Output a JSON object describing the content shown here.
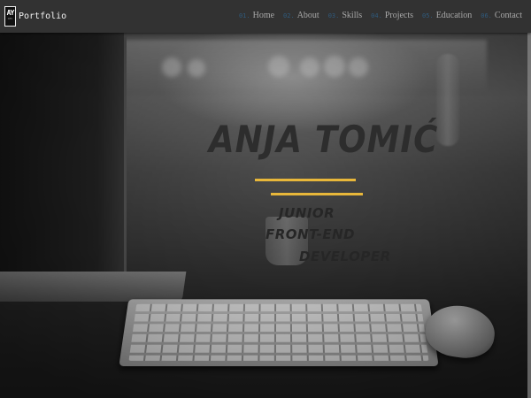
{
  "brand": {
    "logo_mark": "AY",
    "logo_tag": "DEV",
    "name": "Portfolio"
  },
  "nav": {
    "items": [
      {
        "num": "01.",
        "label": "Home"
      },
      {
        "num": "02.",
        "label": "About"
      },
      {
        "num": "03.",
        "label": "Skills"
      },
      {
        "num": "04.",
        "label": "Projects"
      },
      {
        "num": "05.",
        "label": "Education"
      },
      {
        "num": "06.",
        "label": "Contact"
      }
    ]
  },
  "hero": {
    "name": "ANJA TOMIĆ",
    "role_lines": [
      "JUNIOR",
      "FRONT-END",
      "DEVELOPER"
    ]
  },
  "colors": {
    "navbar": "#323232",
    "accent_line": "#e8b73a",
    "nav_number": "#2f5a7c",
    "nav_text": "#a8a8a8",
    "hero_text": "#2d2d2d"
  }
}
